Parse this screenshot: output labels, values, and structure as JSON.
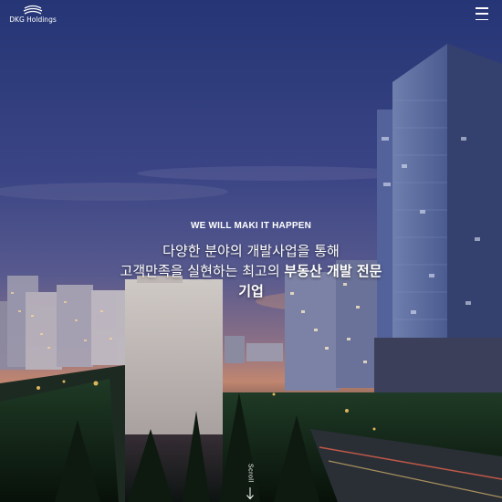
{
  "header": {
    "logo_text": "DKG Holdings",
    "logo_icon": "wave-logo-icon",
    "menu_icon": "hamburger-menu-icon"
  },
  "hero": {
    "eyebrow": "WE WILL MAKI IT HAPPEN",
    "line1": "다양한 분야의 개발사업을 통해",
    "line2_prefix": "고객만족을 실현하는 최고의 ",
    "line2_strong": "부동산 개발 전문",
    "line3_strong": "기업"
  },
  "scroll": {
    "label": "Scroll",
    "icon": "arrow-down-icon"
  },
  "colors": {
    "sky_top": "#2a3a73",
    "sky_mid": "#4a4f86",
    "horizon": "#c88a6e",
    "text": "#ffffff"
  }
}
